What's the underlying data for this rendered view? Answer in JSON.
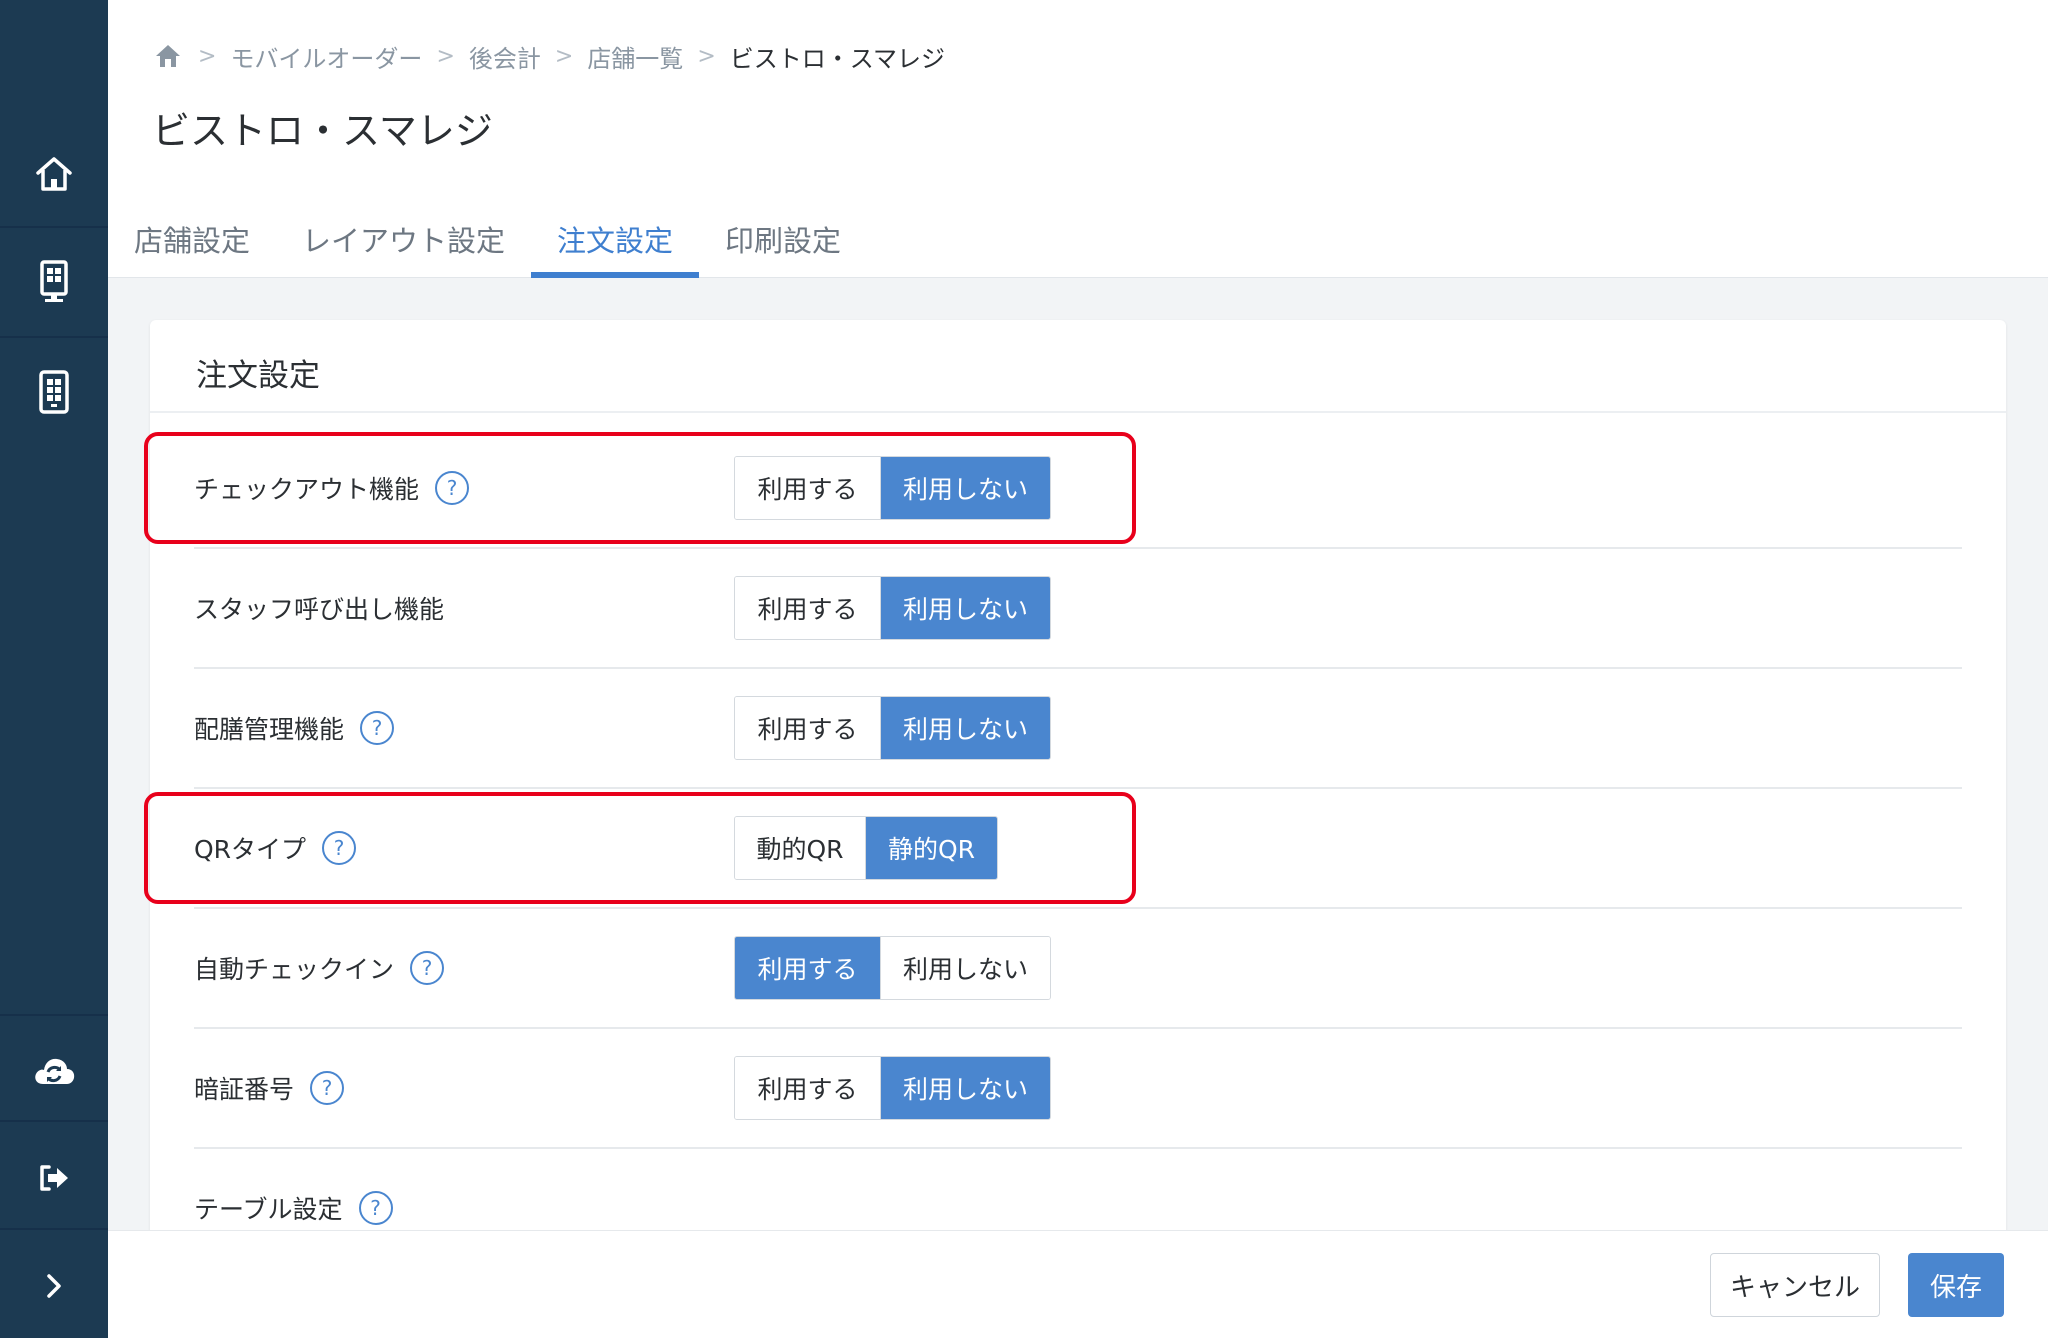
{
  "sidebar": {
    "items": [
      {
        "icon": "home-icon"
      },
      {
        "icon": "order-terminal-icon"
      },
      {
        "icon": "tablet-menu-icon"
      },
      {
        "icon": "cloud-sync-icon"
      },
      {
        "icon": "logout-icon"
      },
      {
        "icon": "chevron-right-icon"
      }
    ]
  },
  "breadcrumb": {
    "items": [
      "モバイルオーダー",
      "後会計",
      "店舗一覧"
    ],
    "current": "ビストロ・スマレジ"
  },
  "page_title": "ビストロ・スマレジ",
  "tabs": [
    {
      "label": "店舗設定",
      "active": false
    },
    {
      "label": "レイアウト設定",
      "active": false
    },
    {
      "label": "注文設定",
      "active": true
    },
    {
      "label": "印刷設定",
      "active": false
    }
  ],
  "card": {
    "title": "注文設定",
    "rows": [
      {
        "label": "チェックアウト機能",
        "help": "?",
        "options": [
          "利用する",
          "利用しない"
        ],
        "selected": "利用しない",
        "highlighted": true
      },
      {
        "label": "スタッフ呼び出し機能",
        "options": [
          "利用する",
          "利用しない"
        ],
        "selected": "利用しない"
      },
      {
        "label": "配膳管理機能",
        "help": "?",
        "options": [
          "利用する",
          "利用しない"
        ],
        "selected": "利用しない"
      },
      {
        "label": "QRタイプ",
        "help": "?",
        "options": [
          "動的QR",
          "静的QR"
        ],
        "selected": "静的QR",
        "highlighted": true
      },
      {
        "label": "自動チェックイン",
        "help": "?",
        "options": [
          "利用する",
          "利用しない"
        ],
        "selected": "利用する"
      },
      {
        "label": "暗証番号",
        "help": "?",
        "options": [
          "利用する",
          "利用しない"
        ],
        "selected": "利用しない"
      },
      {
        "label": "テーブル設定",
        "help": "?"
      }
    ]
  },
  "footer": {
    "cancel_label": "キャンセル",
    "save_label": "保存"
  },
  "colors": {
    "sidebar": "#1c3a52",
    "accent": "#4a86cf",
    "highlight": "#e8001b"
  }
}
